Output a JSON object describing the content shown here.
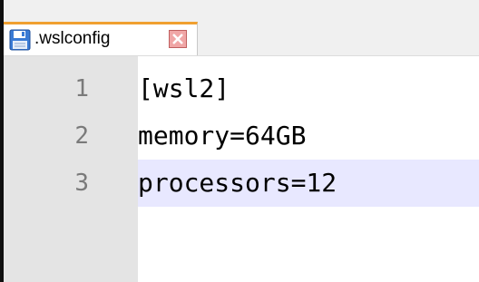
{
  "tab": {
    "filename": ".wslconfig",
    "icon": "floppy-disk-icon",
    "close_icon": "close-icon"
  },
  "editor": {
    "lines": [
      {
        "number": "1",
        "text": "[wsl2]"
      },
      {
        "number": "2",
        "text": "memory=64GB"
      },
      {
        "number": "3",
        "text": "processors=12"
      }
    ],
    "current_line": "3"
  },
  "colors": {
    "current_line_highlight": "#e8e8ff",
    "gutter": "#e4e4e4",
    "tab_accent": "#f0a030",
    "close_button": "#f0a6a6"
  }
}
